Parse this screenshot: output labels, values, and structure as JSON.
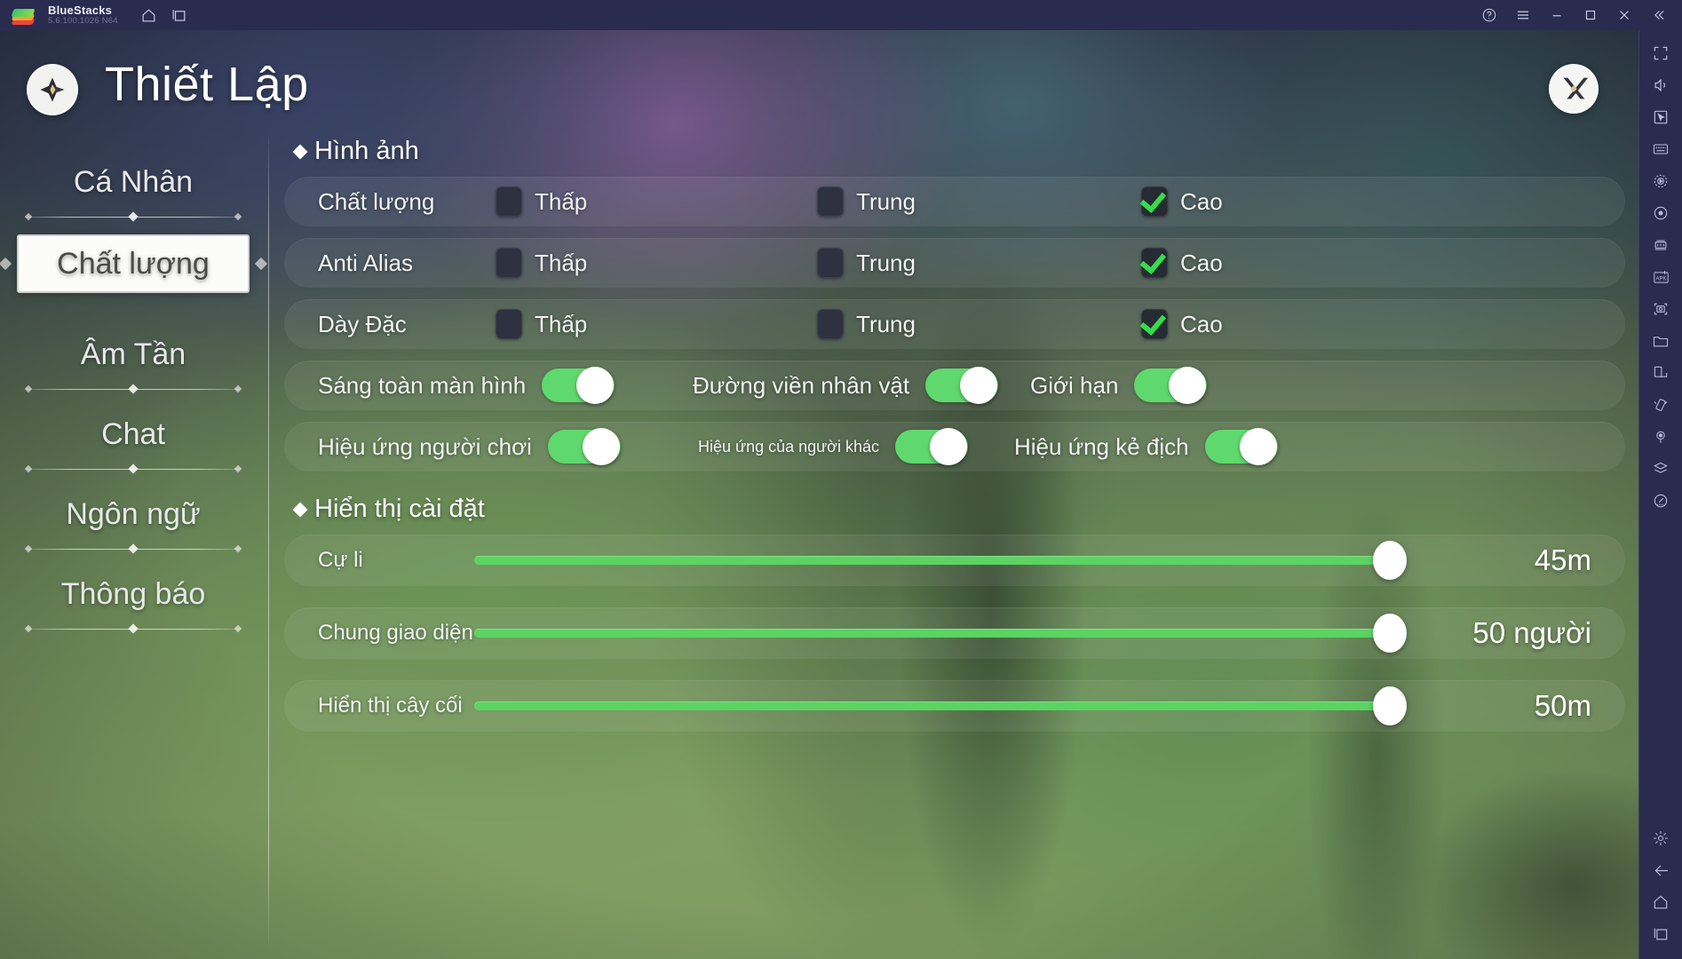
{
  "bluestacks": {
    "app_name": "BlueStacks",
    "version": "5.6.100.1026 N64",
    "nav_icons": [
      "home-icon",
      "recent-apps-icon"
    ],
    "window_controls": [
      "help-icon",
      "menu-icon",
      "minimize-icon",
      "maximize-icon",
      "close-icon",
      "collapse-icon"
    ],
    "toolbar_icons": [
      "fullscreen-icon",
      "volume-icon",
      "pointer-icon",
      "keyboard-icon",
      "game-controls-icon",
      "record-macro-icon",
      "multi-instance-icon",
      "install-apk-icon",
      "screenshot-icon",
      "media-folder-icon",
      "rotate-screen-icon",
      "shake-icon",
      "location-icon",
      "layers-icon",
      "performance-icon"
    ],
    "toolbar_bottom_icons": [
      "settings-gear-icon",
      "back-arrow-icon",
      "home-icon",
      "recent-apps-icon"
    ]
  },
  "header": {
    "title": "Thiết Lập",
    "back_icon": "back-diamond-icon",
    "close_icon": "close-x-icon"
  },
  "sidebar": {
    "items": [
      {
        "label": "Cá Nhân",
        "active": false
      },
      {
        "label": "Chất lượng",
        "active": true
      },
      {
        "label": "Âm Tần",
        "active": false
      },
      {
        "label": "Chat",
        "active": false
      },
      {
        "label": "Ngôn ngữ",
        "active": false
      },
      {
        "label": "Thông báo",
        "active": false
      }
    ]
  },
  "main": {
    "sections": [
      {
        "title": "Hình ảnh",
        "checkbox_rows": [
          {
            "label": "Chất lượng",
            "options": [
              {
                "label": "Thấp",
                "checked": false
              },
              {
                "label": "Trung",
                "checked": false
              },
              {
                "label": "Cao",
                "checked": true
              }
            ]
          },
          {
            "label": "Anti Alias",
            "options": [
              {
                "label": "Thấp",
                "checked": false
              },
              {
                "label": "Trung",
                "checked": false
              },
              {
                "label": "Cao",
                "checked": true
              }
            ]
          },
          {
            "label": "Dày Đặc",
            "options": [
              {
                "label": "Thấp",
                "checked": false
              },
              {
                "label": "Trung",
                "checked": false
              },
              {
                "label": "Cao",
                "checked": true
              }
            ]
          }
        ],
        "toggle_rows": [
          {
            "toggles": [
              {
                "label": "Sáng toàn màn hình",
                "on": true,
                "small": false
              },
              {
                "label": "Đường viền nhân vật",
                "on": true,
                "small": false
              },
              {
                "label": "Giới hạn",
                "on": true,
                "small": false
              }
            ]
          },
          {
            "toggles": [
              {
                "label": "Hiệu ứng người chơi",
                "on": true,
                "small": false
              },
              {
                "label": "Hiệu ứng của người khác",
                "on": true,
                "small": true
              },
              {
                "label": "Hiệu ứng kẻ địch",
                "on": true,
                "small": false
              }
            ]
          }
        ]
      },
      {
        "title": "Hiển thị cài đặt",
        "sliders": [
          {
            "label": "Cự li",
            "value": "45m",
            "percent": 100
          },
          {
            "label": "Chung giao diện",
            "value": "50 người",
            "percent": 100
          },
          {
            "label": "Hiển thị cây cối",
            "value": "50m",
            "percent": 100
          }
        ]
      }
    ]
  },
  "colors": {
    "accent_green": "#5bd462",
    "check_green": "#35dd4a",
    "panel_row": "rgba(255,255,255,0.065)",
    "titlebar": "#2a2c4f"
  }
}
